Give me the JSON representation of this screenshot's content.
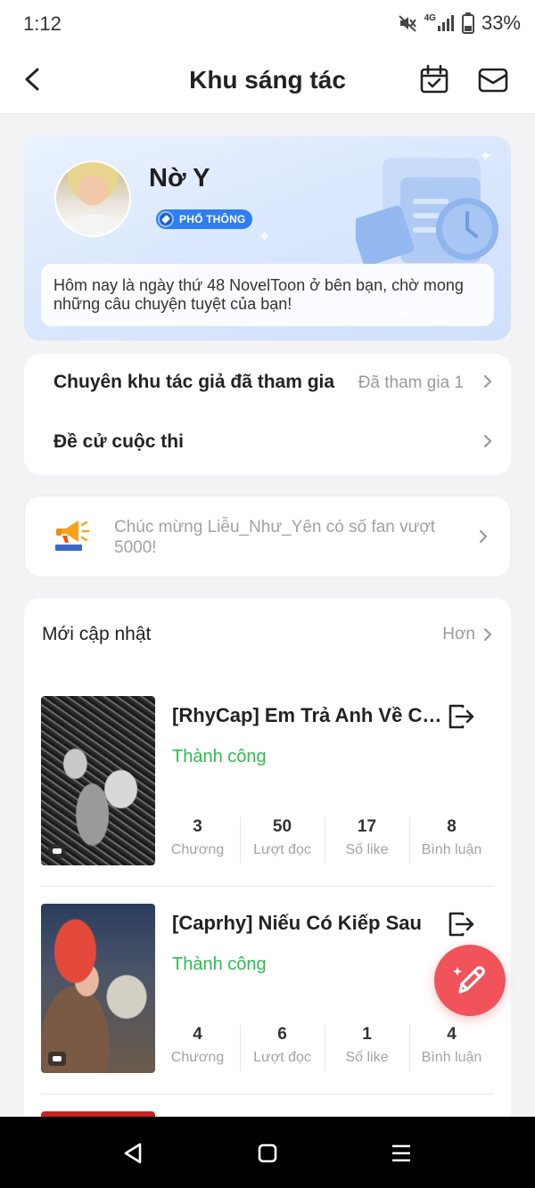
{
  "status_bar": {
    "time": "1:12",
    "network": "4G",
    "battery": "33%"
  },
  "header": {
    "title": "Khu sáng tác"
  },
  "profile": {
    "name": "Nờ Y",
    "level": "PHỔ THÔNG",
    "greeting": "Hôm nay là ngày thứ 48 NovelToon ở bên bạn, chờ mong những câu chuyện tuyệt của bạn!"
  },
  "menu": {
    "items": [
      {
        "label": "Chuyên khu tác giả đã tham gia",
        "value": "Đã tham gia 1"
      },
      {
        "label": "Đề cử cuộc thi",
        "value": ""
      }
    ]
  },
  "notice": {
    "text": "Chúc mừng Liễu_Như_Yên có số fan vượt 5000!"
  },
  "updates": {
    "title": "Mới cập nhật",
    "more_label": "Hơn",
    "stories": [
      {
        "title": "[RhyCap] Em Trả Anh Về Chốn Cũ",
        "status": "Thành công",
        "stats": [
          {
            "value": "3",
            "label": "Chương"
          },
          {
            "value": "50",
            "label": "Lượt đọc"
          },
          {
            "value": "17",
            "label": "Số like"
          },
          {
            "value": "8",
            "label": "Bình luận"
          }
        ]
      },
      {
        "title": "[Caprhy] Niếu Có Kiếp Sau",
        "status": "Thành công",
        "stats": [
          {
            "value": "4",
            "label": "Chương"
          },
          {
            "value": "6",
            "label": "Lượt đọc"
          },
          {
            "value": "1",
            "label": "Số like"
          },
          {
            "value": "4",
            "label": "Bình luận"
          }
        ]
      }
    ]
  },
  "colors": {
    "success": "#2dbb52",
    "fab": "#f0535a",
    "badge": "#2f7ef0"
  },
  "icons": [
    "back-arrow-icon",
    "calendar-check-icon",
    "mail-icon",
    "chevron-right-icon",
    "megaphone-icon",
    "exit-icon",
    "pencil-icon"
  ]
}
